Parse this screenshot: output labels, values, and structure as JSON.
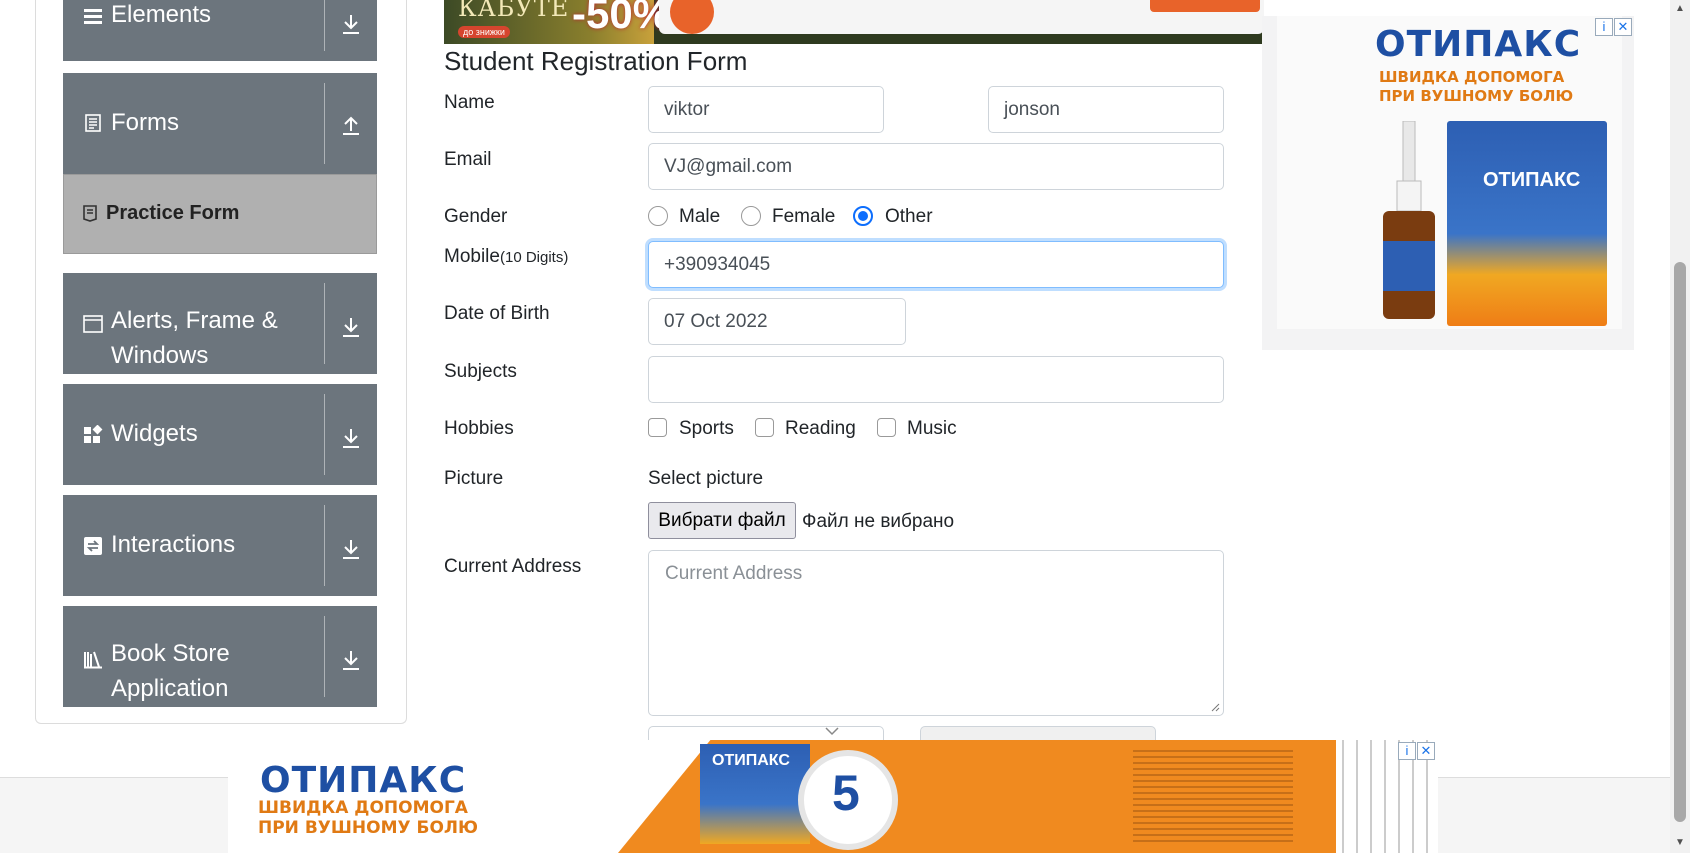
{
  "sidebar": {
    "groups": [
      {
        "label": "Elements",
        "icon": "hamburger-icon",
        "expanded": false
      },
      {
        "label": "Forms",
        "icon": "document-icon",
        "expanded": true
      },
      {
        "label": "Alerts, Frame &",
        "label2": "Windows",
        "icon": "window-icon",
        "expanded": false
      },
      {
        "label": "Widgets",
        "icon": "widgets-icon",
        "expanded": false
      },
      {
        "label": "Interactions",
        "icon": "interactions-icon",
        "expanded": false
      },
      {
        "label": "Book Store",
        "label2": "Application",
        "icon": "books-icon",
        "expanded": false
      }
    ],
    "active_item": "Practice Form"
  },
  "form": {
    "title": "Student Registration Form",
    "name_label": "Name",
    "first_name": "viktor",
    "last_name": "jonson",
    "email_label": "Email",
    "email": "VJ@gmail.com",
    "gender_label": "Gender",
    "gender_options": [
      "Male",
      "Female",
      "Other"
    ],
    "gender_selected": "Other",
    "mobile_label": "Mobile",
    "mobile_hint": "(10 Digits)",
    "mobile": "+390934045",
    "dob_label": "Date of Birth",
    "dob": "07 Oct 2022",
    "subjects_label": "Subjects",
    "subjects_value": "",
    "hobbies_label": "Hobbies",
    "hobbies": [
      "Sports",
      "Reading",
      "Music"
    ],
    "picture_label": "Picture",
    "picture_select": "Select picture",
    "file_button": "Вибрати файл",
    "file_status": "Файл не вибрано",
    "address_label": "Current Address",
    "address_placeholder": "Current Address"
  },
  "ads": {
    "right_brand": "ОТИПАКС",
    "right_slogan": "ШВИДКА ДОПОМОГА ПРИ ВУШНОМУ БОЛЮ",
    "right_box_brand": "ОТИПАКС",
    "bottom_brand": "ОТИПАКС",
    "bottom_slogan_line1": "ШВИДКА ДОПОМОГА",
    "bottom_slogan_line2": "ПРИ ВУШНОМУ БОЛЮ",
    "bottom_box_brand": "ОТИПАКС",
    "bottom_clock_number": "5",
    "top_brand": "КАБУТЕ",
    "top_discount": "-50%",
    "top_tag": "до знижки",
    "close_symbol": "✕",
    "info_symbol": "i"
  },
  "colors": {
    "sidebar_bg": "#6c757d",
    "active_item_bg": "#b0b0b0",
    "accent": "#0d6efd",
    "ad_orange": "#f08a1f",
    "ad_blue": "#1e4fa3"
  }
}
